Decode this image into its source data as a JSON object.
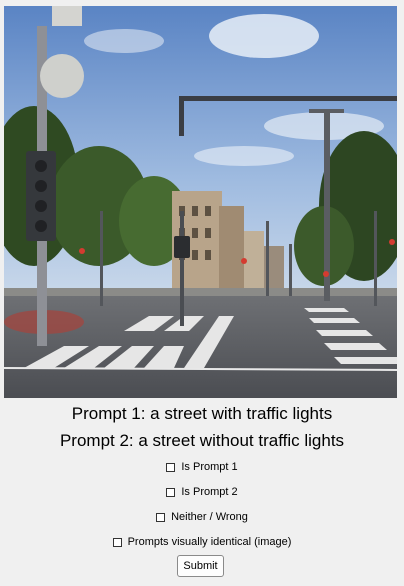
{
  "prompts": {
    "prompt1": "Prompt 1: a street with traffic lights",
    "prompt2": "Prompt 2: a street without traffic lights"
  },
  "options": [
    {
      "label": "Is Prompt 1",
      "checked": false
    },
    {
      "label": "Is Prompt 2",
      "checked": false
    },
    {
      "label": "Neither / Wrong",
      "checked": false
    },
    {
      "label": "Prompts visually identical (image)",
      "checked": false
    }
  ],
  "submit_label": "Submit",
  "image": {
    "subject": "street-scene-with-traffic-lights"
  }
}
